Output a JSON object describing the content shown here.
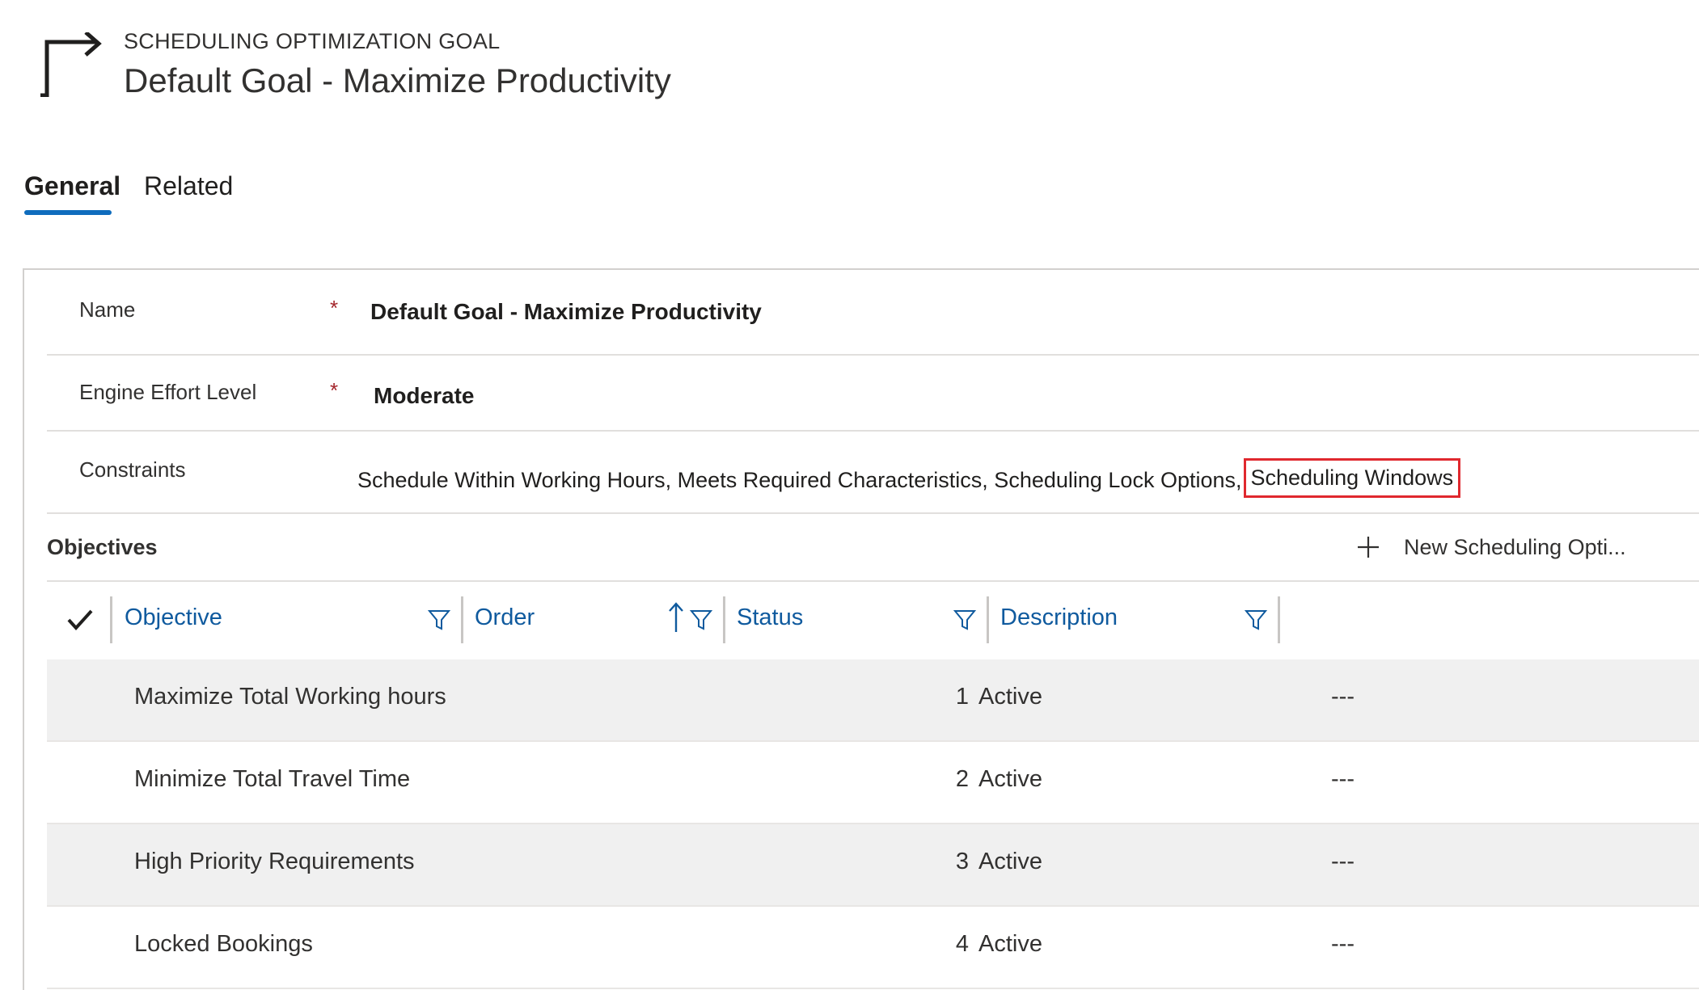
{
  "header": {
    "entity_type": "SCHEDULING OPTIMIZATION GOAL",
    "record_title": "Default Goal - Maximize Productivity",
    "icon": "goal-arrow-icon"
  },
  "tabs": [
    {
      "label": "General",
      "active": true
    },
    {
      "label": "Related",
      "active": false
    }
  ],
  "form": {
    "name": {
      "label": "Name",
      "required": "*",
      "value": "Default Goal - Maximize Productivity"
    },
    "engine_effort": {
      "label": "Engine Effort Level",
      "required": "*",
      "value": "Moderate"
    },
    "constraints": {
      "label": "Constraints",
      "value_prefix": "Schedule Within Working Hours, Meets Required Characteristics, Scheduling Lock Options,",
      "value_highlighted": "Scheduling Windows",
      "highlight_color": "#e0282e"
    }
  },
  "objectives": {
    "title": "Objectives",
    "new_button_label": "New Scheduling Opti...",
    "columns": [
      "Objective",
      "Order",
      "Status",
      "Description"
    ],
    "rows": [
      {
        "objective": "Maximize Total Working hours",
        "order": "1",
        "status": "Active",
        "description": "---"
      },
      {
        "objective": "Minimize Total Travel Time",
        "order": "2",
        "status": "Active",
        "description": "---"
      },
      {
        "objective": "High Priority Requirements",
        "order": "3",
        "status": "Active",
        "description": "---"
      },
      {
        "objective": "Locked Bookings",
        "order": "4",
        "status": "Active",
        "description": "---"
      }
    ]
  },
  "colors": {
    "accent": "#0f6cbd",
    "link": "#0f5a9e",
    "required": "#a4262c",
    "row_shade": "#f0f0f0"
  }
}
